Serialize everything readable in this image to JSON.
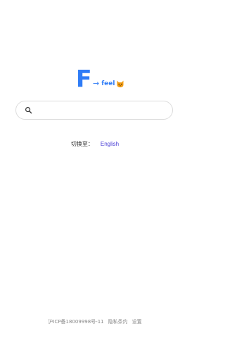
{
  "logo": {
    "letter": "F",
    "arrow": "→",
    "word": "feel",
    "emoji_icon": "cat-face-icon",
    "color": "#2f7cf6"
  },
  "search": {
    "placeholder": "",
    "value": "",
    "icon": "search-icon"
  },
  "language": {
    "label": "切换至：",
    "link": "English",
    "link_color": "#4a3fd6"
  },
  "footer": {
    "icp": "沪ICP备18009998号-11",
    "privacy": "隐私条约",
    "settings": "设置"
  }
}
